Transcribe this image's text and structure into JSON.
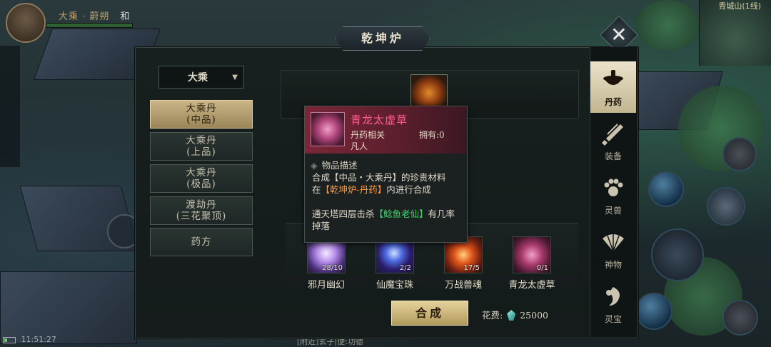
{
  "hud": {
    "player_name": "大乘 · 蔚朔",
    "status_char": "和",
    "clock": "11:51:27",
    "minimap_title": "青城山(1线)",
    "chat_preview": "[附近]玄子|便:功德"
  },
  "window": {
    "title": "乾坤炉",
    "close_label": "✕"
  },
  "realm_select": {
    "value": "大乘"
  },
  "recipes": [
    {
      "label": "大乘丹\n(中品)",
      "active": true
    },
    {
      "label": "大乘丹\n(上品)",
      "active": false
    },
    {
      "label": "大乘丹\n(极品)",
      "active": false
    },
    {
      "label": "渡劫丹\n(三花聚顶)",
      "active": false
    },
    {
      "label": "药方",
      "active": false
    }
  ],
  "tooltip": {
    "name": "青龙太虚草",
    "category": "丹药相关",
    "owned": "拥有:0",
    "rank": "凡人",
    "desc_title": "物品描述",
    "line1_a": "合成【中品・大乘丹】的珍贵材料",
    "line2_a": "在",
    "line2_hl": "【乾坤炉-丹药】",
    "line2_b": "内进行合成",
    "line3_a": "通天塔四层击杀",
    "line3_hl": "【鲶鱼老仙】",
    "line3_b": "有几率掉落"
  },
  "ingredients": [
    {
      "name": "邪月幽幻",
      "count": "28/10"
    },
    {
      "name": "仙魔宝珠",
      "count": "2/2"
    },
    {
      "name": "万战兽魂",
      "count": "17/5"
    },
    {
      "name": "青龙太虚草",
      "count": "0/1"
    }
  ],
  "craft": {
    "button_label": "合成",
    "cost_label": "花费:",
    "cost_value": "25000"
  },
  "tabs": [
    {
      "label": "丹药",
      "icon": "mortar-icon",
      "active": true
    },
    {
      "label": "装备",
      "icon": "sword-icon",
      "active": false
    },
    {
      "label": "灵兽",
      "icon": "paw-icon",
      "active": false
    },
    {
      "label": "神物",
      "icon": "fan-icon",
      "active": false
    },
    {
      "label": "灵宝",
      "icon": "treasure-icon",
      "active": false
    }
  ]
}
